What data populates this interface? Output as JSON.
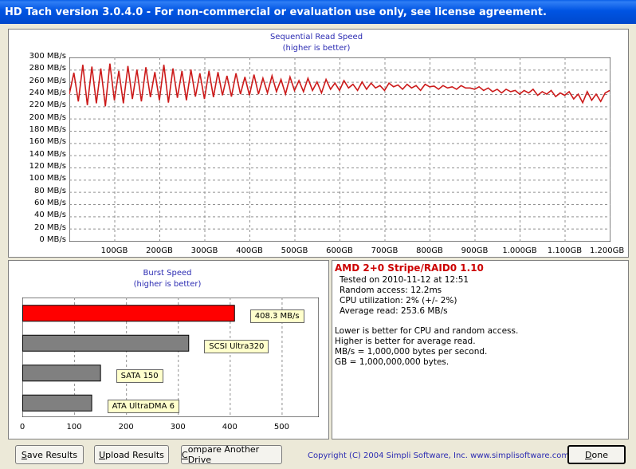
{
  "window": {
    "title": "HD Tach version 3.0.4.0  - For non-commercial or evaluation use only, see license agreement."
  },
  "colors": {
    "line": "#cc1a1a",
    "bar_primary": "#ff0000",
    "bar_other": "#808080",
    "label_bg": "#ffffcc",
    "accent_text": "#2b2bb2",
    "drive_name": "#cc0000"
  },
  "chart_data": [
    {
      "type": "line",
      "title": "Sequential Read Speed",
      "subtitle": "(higher is better)",
      "y_ticks": [
        "300 MB/s",
        "280 MB/s",
        "260 MB/s",
        "240 MB/s",
        "220 MB/s",
        "200 MB/s",
        "180 MB/s",
        "160 MB/s",
        "140 MB/s",
        "120 MB/s",
        "100 MB/s",
        "80 MB/s",
        "60 MB/s",
        "40 MB/s",
        "20 MB/s",
        "0 MB/s"
      ],
      "x_ticks": [
        "100GB",
        "200GB",
        "300GB",
        "400GB",
        "500GB",
        "600GB",
        "700GB",
        "800GB",
        "900GB",
        "1.000GB",
        "1.100GB",
        "1.200GB"
      ],
      "ylim": [
        0,
        300
      ],
      "xlim": [
        0,
        1200
      ],
      "grid": true,
      "series": [
        {
          "x": [
            0,
            10,
            20,
            30,
            40,
            50,
            60,
            70,
            80,
            90,
            100,
            110,
            120,
            130,
            140,
            150,
            160,
            170,
            180,
            190,
            200,
            210,
            220,
            230,
            240,
            250,
            260,
            270,
            280,
            290,
            300,
            310,
            320,
            330,
            340,
            350,
            360,
            370,
            380,
            390,
            400,
            410,
            420,
            430,
            440,
            450,
            460,
            470,
            480,
            490,
            500,
            510,
            520,
            530,
            540,
            550,
            560,
            570,
            580,
            590,
            600,
            610,
            620,
            630,
            640,
            650,
            660,
            670,
            680,
            690,
            700,
            710,
            720,
            730,
            740,
            750,
            760,
            770,
            780,
            790,
            800,
            810,
            820,
            830,
            840,
            850,
            860,
            870,
            880,
            890,
            900,
            910,
            920,
            930,
            940,
            950,
            960,
            970,
            980,
            990,
            1000,
            1010,
            1020,
            1030,
            1040,
            1050,
            1060,
            1070,
            1080,
            1090,
            1100,
            1110,
            1120,
            1130,
            1140,
            1150,
            1160,
            1170,
            1180,
            1190,
            1200
          ],
          "values": [
            240,
            275,
            228,
            288,
            222,
            285,
            225,
            282,
            220,
            290,
            230,
            278,
            225,
            286,
            232,
            280,
            228,
            284,
            235,
            276,
            230,
            288,
            226,
            282,
            234,
            278,
            230,
            280,
            236,
            274,
            232,
            278,
            235,
            276,
            238,
            270,
            236,
            274,
            240,
            268,
            238,
            272,
            240,
            266,
            242,
            270,
            244,
            264,
            240,
            268,
            246,
            262,
            244,
            266,
            246,
            260,
            242,
            264,
            248,
            258,
            246,
            262,
            250,
            256,
            246,
            260,
            248,
            258,
            250,
            254,
            246,
            258,
            252,
            255,
            248,
            256,
            250,
            254,
            246,
            256,
            252,
            253,
            248,
            254,
            250,
            252,
            248,
            254,
            250,
            250,
            248,
            252,
            246,
            250,
            244,
            248,
            242,
            248,
            244,
            246,
            240,
            246,
            242,
            248,
            238,
            244,
            240,
            246,
            236,
            242,
            238,
            244,
            232,
            240,
            226,
            244,
            230,
            240,
            228,
            242,
            246
          ]
        }
      ]
    },
    {
      "type": "bar",
      "title": "Burst Speed",
      "subtitle": "(higher is better)",
      "categories": [
        "408.3 MB/s",
        "SCSI Ultra320",
        "SATA 150",
        "ATA UltraDMA 6"
      ],
      "values": [
        408.3,
        320,
        150,
        133
      ],
      "x_ticks": [
        "0",
        "100",
        "200",
        "300",
        "400",
        "500"
      ],
      "xlim": [
        0,
        570
      ],
      "grid": true
    }
  ],
  "info": {
    "drive_name": "AMD 2+0 Stripe/RAID0 1.10",
    "tested": "Tested on 2010-11-12 at 12:51",
    "random_access": "Random access: 12.2ms",
    "cpu": "CPU utilization: 2% (+/- 2%)",
    "average": "Average read: 253.6 MB/s",
    "note1": "Lower is better for CPU and random access.",
    "note2": "Higher is better for average read.",
    "note3": "MB/s = 1,000,000 bytes per second.",
    "note4": "GB = 1,000,000,000 bytes."
  },
  "buttons": {
    "save_first": "S",
    "save_rest": "ave Results",
    "upload_first": "U",
    "upload_rest": "pload Results",
    "compare_first": "C",
    "compare_rest": "ompare Another Drive",
    "done_first": "D",
    "done_rest": "one"
  },
  "footer": {
    "copyright": "Copyright (C) 2004 Simpli Software, Inc. www.simplisoftware.com"
  }
}
